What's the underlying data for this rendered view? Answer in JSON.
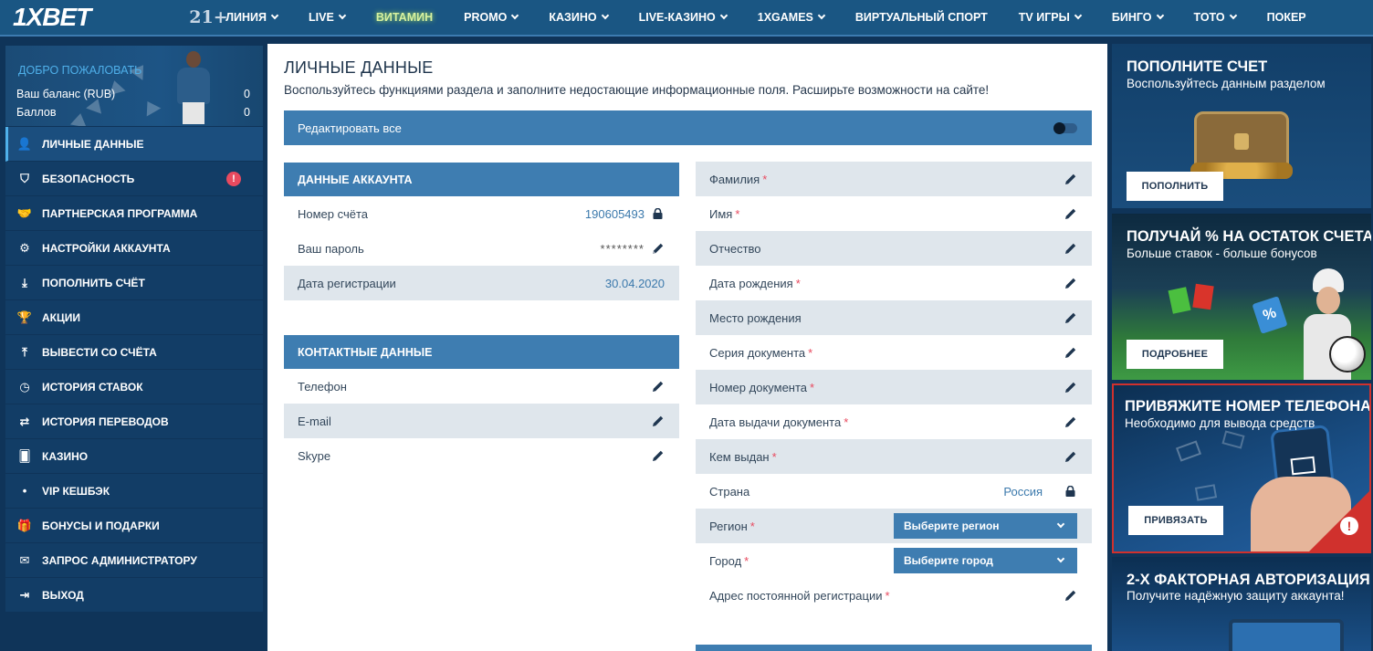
{
  "topbar": {
    "logo": "1XBET",
    "age": "21+",
    "nav": [
      {
        "label": "ЛИНИЯ",
        "chevron": true
      },
      {
        "label": "LIVE",
        "chevron": true
      },
      {
        "label": "ВИТАМИН",
        "chevron": false
      },
      {
        "label": "PROMO",
        "chevron": true
      },
      {
        "label": "КАЗИНО",
        "chevron": true
      },
      {
        "label": "LIVE-КАЗИНО",
        "chevron": true
      },
      {
        "label": "1XGAMES",
        "chevron": true
      },
      {
        "label": "ВИРТУАЛЬНЫЙ СПОРТ",
        "chevron": false
      },
      {
        "label": "TV ИГРЫ",
        "chevron": true
      },
      {
        "label": "БИНГО",
        "chevron": true
      },
      {
        "label": "ТОТО",
        "chevron": true
      },
      {
        "label": "ПОКЕР",
        "chevron": false
      }
    ]
  },
  "sidebar": {
    "welcome": "ДОБРО ПОЖАЛОВАТЬ",
    "balance_label": "Ваш баланс (RUB)",
    "balance_value": "0",
    "points_label": "Баллов",
    "points_value": "0",
    "alert_mark": "!",
    "items": [
      {
        "label": "ЛИЧНЫЕ ДАННЫЕ",
        "icon": "user-edit-icon"
      },
      {
        "label": "БЕЗОПАСНОСТЬ",
        "icon": "shield-icon"
      },
      {
        "label": "ПАРТНЕРСКАЯ ПРОГРАММА",
        "icon": "handshake-icon"
      },
      {
        "label": "НАСТРОЙКИ АККАУНТА",
        "icon": "gears-icon"
      },
      {
        "label": "ПОПОЛНИТЬ СЧЁТ",
        "icon": "download-icon"
      },
      {
        "label": "АКЦИИ",
        "icon": "trophy-icon"
      },
      {
        "label": "ВЫВЕСТИ СО СЧЁТА",
        "icon": "upload-icon"
      },
      {
        "label": "ИСТОРИЯ СТАВОК",
        "icon": "clock-icon"
      },
      {
        "label": "ИСТОРИЯ ПЕРЕВОДОВ",
        "icon": "transfer-arrows-icon"
      },
      {
        "label": "КАЗИНО",
        "icon": "cards-icon"
      },
      {
        "label": "VIP КЕШБЭК",
        "icon": "dot-icon"
      },
      {
        "label": "БОНУСЫ И ПОДАРКИ",
        "icon": "gift-icon"
      },
      {
        "label": "ЗАПРОС АДМИНИСТРАТОРУ",
        "icon": "envelope-icon"
      },
      {
        "label": "ВЫХОД",
        "icon": "logout-icon"
      }
    ]
  },
  "main": {
    "title": "ЛИЧНЫЕ ДАННЫЕ",
    "subtitle": "Воспользуйтесь функциями раздела и заполните недостающие информационные поля. Расширьте возможности на сайте!",
    "edit_all": "Редактировать все",
    "account": {
      "header": "ДАННЫЕ АККАУНТА",
      "account_number_label": "Номер счёта",
      "account_number": "190605493",
      "password_label": "Ваш пароль",
      "password": "********",
      "reg_date_label": "Дата регистрации",
      "reg_date": "30.04.2020"
    },
    "contacts": {
      "header": "КОНТАКТНЫЕ ДАННЫЕ",
      "phone_label": "Телефон",
      "email_label": "E-mail",
      "skype_label": "Skype"
    },
    "personal": {
      "required_mark": "*",
      "surname": "Фамилия",
      "name": "Имя",
      "patronymic": "Отчество",
      "birth_date": "Дата рождения",
      "birth_place": "Место рождения",
      "doc_series": "Серия документа",
      "doc_number": "Номер документа",
      "doc_issue_date": "Дата выдачи документа",
      "doc_issued_by": "Кем выдан",
      "country_label": "Страна",
      "country": "Россия",
      "region_label": "Регион",
      "region_placeholder": "Выберите регион",
      "city_label": "Город",
      "city_placeholder": "Выберите город",
      "address": "Адрес постоянной регистрации"
    }
  },
  "promos": {
    "topup": {
      "title": "ПОПОЛНИТЕ СЧЕТ",
      "subtitle": "Воспользуйтесь данным разделом",
      "button": "ПОПОЛНИТЬ"
    },
    "interest": {
      "title": "ПОЛУЧАЙ % НА ОСТАТОК СЧЕТА",
      "subtitle": "Больше ставок - больше бонусов",
      "button": "ПОДРОБНЕЕ",
      "badge": "%"
    },
    "phone": {
      "title": "ПРИВЯЖИТЕ НОМЕР ТЕЛЕФОНА",
      "subtitle": "Необходимо для вывода средств",
      "button": "ПРИВЯЗАТЬ",
      "warning": "!"
    },
    "twofa": {
      "title": "2-Х ФАКТОРНАЯ АВТОРИЗАЦИЯ",
      "subtitle": "Получите надёжную защиту аккаунта!"
    }
  },
  "colors": {
    "topbar": "#1a5683",
    "page_bg": "#0f3459",
    "section_header": "#3e7db1",
    "row_shade": "#dfe6ec",
    "value_blue": "#3b79ac",
    "required": "#e84a5f",
    "alert_red": "#e84a5f",
    "promo_red_border": "#d0312d"
  }
}
